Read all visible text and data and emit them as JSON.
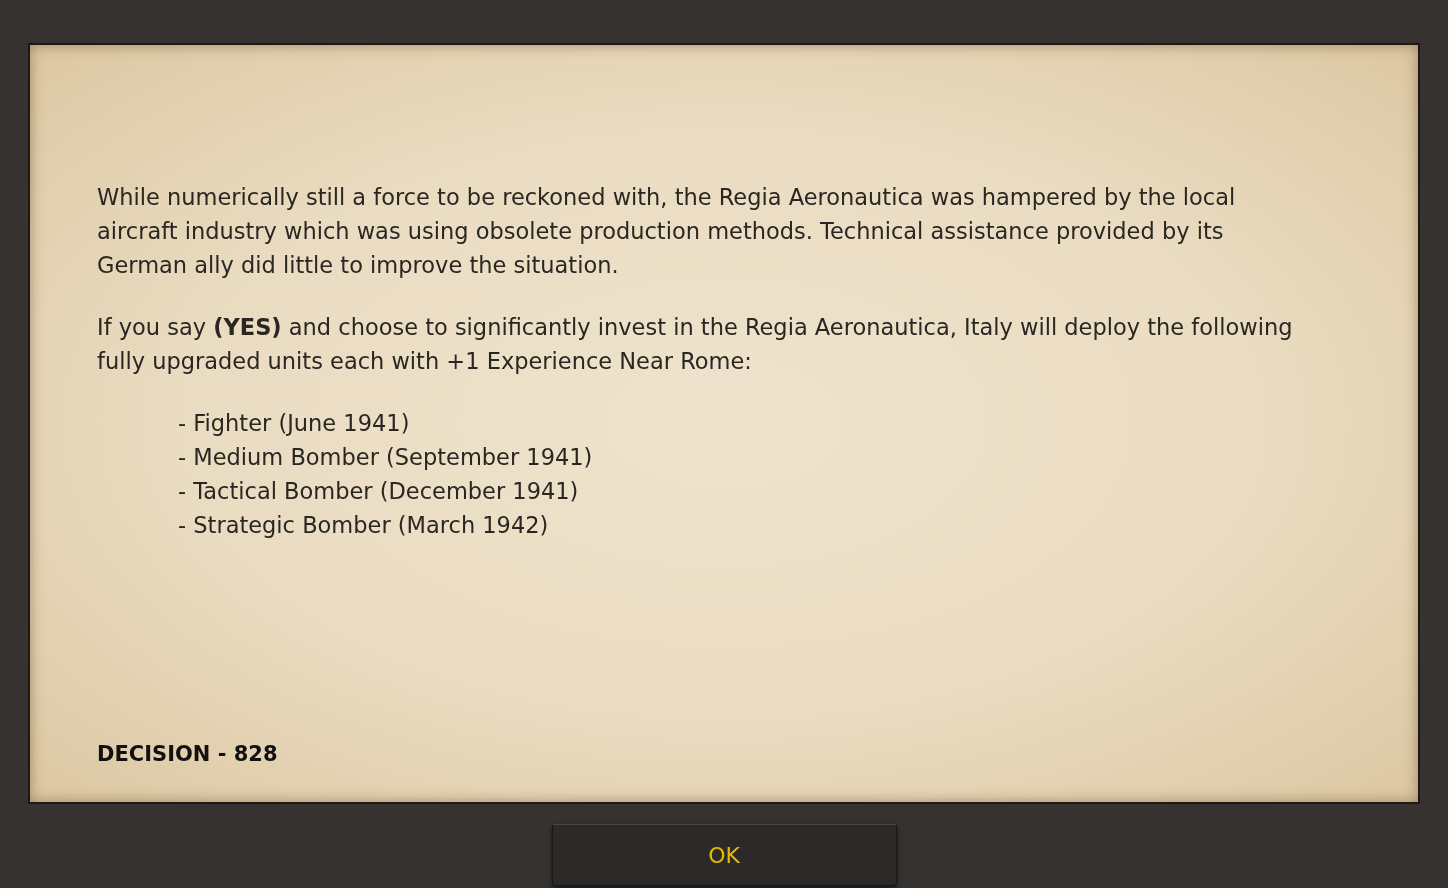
{
  "message": {
    "paragraphs": [
      "While numerically still a force to be reckoned with, the Regia Aeronautica was hampered by the local aircraft industry which was using obsolete production methods. Technical assistance provided by its German ally did little to improve the situation.",
      "If you say **(YES)** and choose to significantly invest in the Regia Aeronautica, Italy will deploy the following fully upgraded units each with +1 Experience Near Rome:"
    ],
    "units": [
      "- Fighter (June 1941)",
      "- Medium Bomber (September 1941)",
      "- Tactical Bomber (December 1941)",
      "- Strategic Bomber (March 1942)"
    ],
    "decision": "DECISION - 828"
  },
  "buttons": [
    {
      "label": "OK"
    }
  ]
}
